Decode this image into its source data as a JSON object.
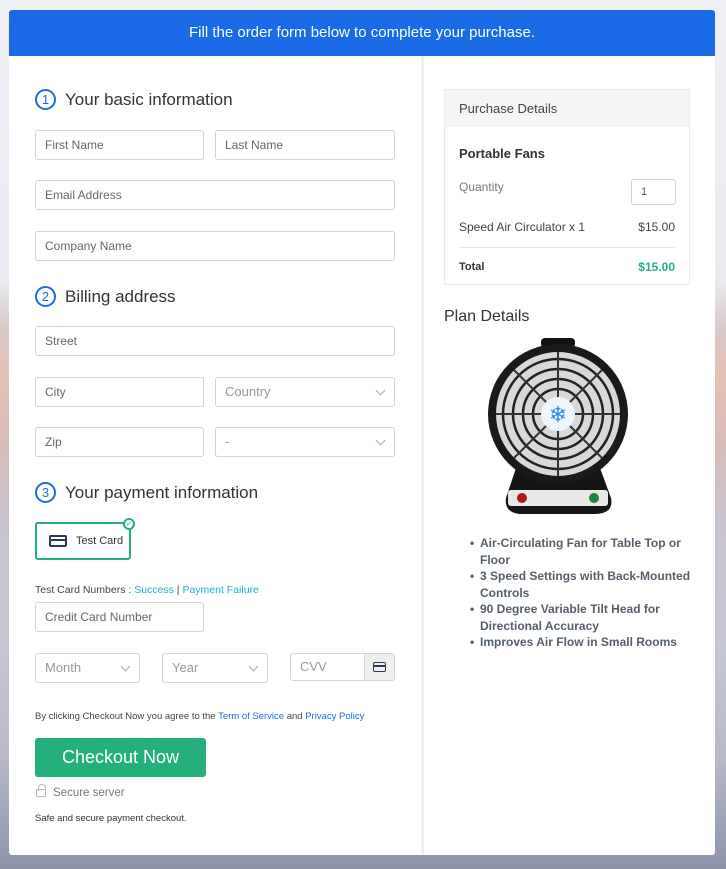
{
  "header": {
    "text": "Fill the order form below to complete your purchase."
  },
  "sections": {
    "basic": {
      "step": "1",
      "title": "Your basic information"
    },
    "billing": {
      "step": "2",
      "title": "Billing address"
    },
    "payment": {
      "step": "3",
      "title": "Your payment information"
    }
  },
  "fields": {
    "first_name": "First Name",
    "last_name": "Last Name",
    "email": "Email Address",
    "company": "Company Name",
    "street": "Street",
    "city": "City",
    "country": "Country",
    "zip": "Zip",
    "state": "-",
    "card_number": "Credit Card Number",
    "month": "Month",
    "year": "Year",
    "cvv": "CVV"
  },
  "payment": {
    "method_label": "Test Card",
    "test_numbers_label": "Test Card Numbers : ",
    "success_link": "Success",
    "separator": " | ",
    "failure_link": "Payment Failure"
  },
  "terms": {
    "prefix": "By clicking Checkout Now you agree to the ",
    "tos_link": "Term of Service",
    "and": " and ",
    "privacy_link": "Privacy Policy"
  },
  "checkout": {
    "button_label": "Checkout Now",
    "secure_label": "Secure server",
    "safe_text": "Safe and secure payment checkout."
  },
  "purchase_details": {
    "title": "Purchase Details",
    "product": "Portable Fans",
    "quantity_label": "Quantity",
    "quantity_value": "1",
    "item_label": "Speed Air Circulator x 1",
    "item_price": "$15.00",
    "total_label": "Total",
    "total_value": "$15.00"
  },
  "plan_details": {
    "title": "Plan Details",
    "features": [
      "Air-Circulating Fan for Table Top or Floor",
      "3 Speed Settings with Back-Mounted Controls",
      "90 Degree Variable Tilt Head for Directional Accuracy",
      "Improves Air Flow in Small Rooms"
    ]
  },
  "colors": {
    "primary": "#1c6be6",
    "success": "#23b07a",
    "link_teal": "#1cb0c9"
  }
}
